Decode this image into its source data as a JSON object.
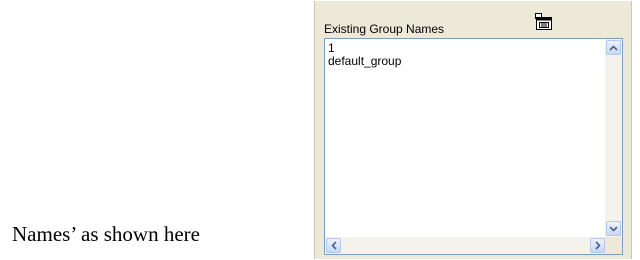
{
  "caption": {
    "text": "Names’ as shown here"
  },
  "panel": {
    "title": "Existing Group Names",
    "tool_icon": "group-edit-icon"
  },
  "list": {
    "items": [
      "1",
      "default_group"
    ]
  },
  "scrollbars": {
    "up_icon": "chevron-up-icon",
    "down_icon": "chevron-down-icon",
    "left_icon": "chevron-left-icon",
    "right_icon": "chevron-right-icon"
  },
  "colors": {
    "panel_bg": "#ece9d8",
    "list_border": "#7f9db9",
    "scroll_arrow": "#4d6185"
  }
}
